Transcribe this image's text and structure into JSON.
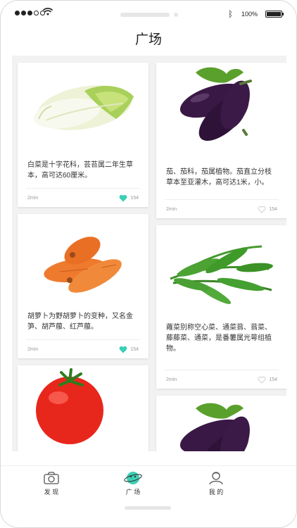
{
  "status_bar": {
    "battery_percent_text": "100%",
    "signal_dots_filled": 3,
    "signal_dots_total": 5
  },
  "header": {
    "title": "广场"
  },
  "feed": {
    "left_column": [
      {
        "image": "napa-cabbage-photo",
        "text": "白菜是十字花科，芸苔属二年生草本，高可达60厘米。",
        "time": "2min",
        "likes": "154",
        "liked": true
      },
      {
        "image": "carrots-photo",
        "text": "胡萝卜为野胡萝卜的变种，又名金笋、胡芦菔、红芦菔。",
        "time": "2min",
        "likes": "154",
        "liked": true
      },
      {
        "image": "tomato-photo",
        "text": "",
        "time": "",
        "likes": "",
        "liked": false
      }
    ],
    "right_column": [
      {
        "image": "eggplant-photo",
        "text": "茄、茄科，茄属植物。茄直立分枝草本至亚灌木，高可达1米，小。",
        "time": "2min",
        "likes": "154",
        "liked": false
      },
      {
        "image": "water-spinach-photo",
        "text": "蕹菜别称空心菜、通菜蓊、蓊菜、藤藤菜、通菜，是番薯属光萼组植物。",
        "time": "2min",
        "likes": "154",
        "liked": false
      },
      {
        "image": "eggplant-photo",
        "text": "",
        "time": "",
        "likes": "",
        "liked": false
      }
    ]
  },
  "tab_bar": {
    "tabs": [
      {
        "label": "发 现",
        "icon": "camera-icon",
        "active": false
      },
      {
        "label": "广 场",
        "icon": "planet-icon",
        "active": true
      },
      {
        "label": "我 的",
        "icon": "person-icon",
        "active": false
      }
    ]
  },
  "colors": {
    "accent": "#3dcfb6",
    "heart_inactive": "#cccccc",
    "feed_background": "#f2f2f2"
  }
}
